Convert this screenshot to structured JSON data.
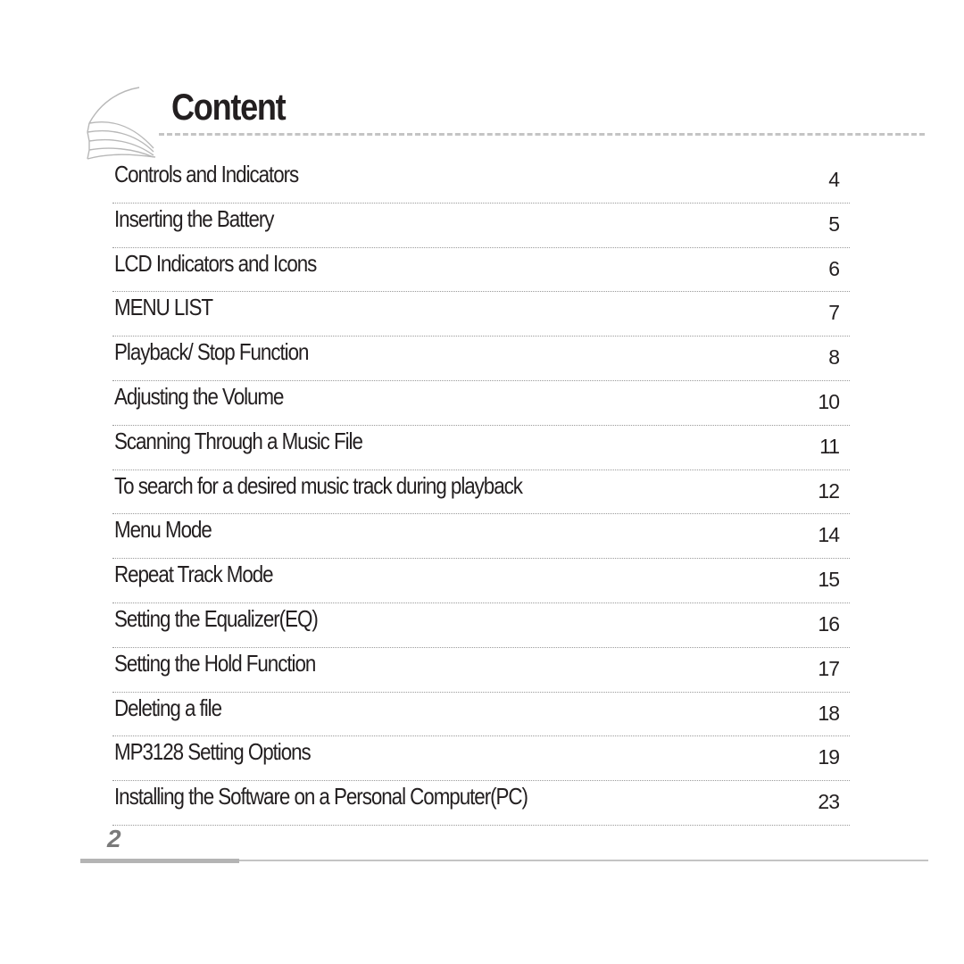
{
  "header": {
    "title": "Content"
  },
  "toc": [
    {
      "label": "Controls and Indicators",
      "page": "4"
    },
    {
      "label": "Inserting  the Battery",
      "page": "5"
    },
    {
      "label": "LCD Indicators and Icons",
      "page": "6"
    },
    {
      "label": "MENU LIST",
      "page": "7"
    },
    {
      "label": "Playback/ Stop Function",
      "page": "8"
    },
    {
      "label": "Adjusting  the Volume",
      "page": "10"
    },
    {
      "label": "Scanning Through a Music File",
      "page": "11"
    },
    {
      "label": "To search for a desired music track during playback",
      "page": "12"
    },
    {
      "label": "Menu Mode",
      "page": "14"
    },
    {
      "label": "Repeat Track Mode",
      "page": "15"
    },
    {
      "label": "Setting the Equalizer(EQ)",
      "page": "16"
    },
    {
      "label": "Setting the Hold Function",
      "page": "17"
    },
    {
      "label": "Deleting a file",
      "page": "18"
    },
    {
      "label": "MP3128 Setting Options",
      "page": "19"
    },
    {
      "label": "Installing the Software on a Personal Computer(PC)",
      "page": "23"
    }
  ],
  "footer": {
    "page_number": "2"
  },
  "icons": {
    "logo": "curved-lines-logo-icon"
  }
}
